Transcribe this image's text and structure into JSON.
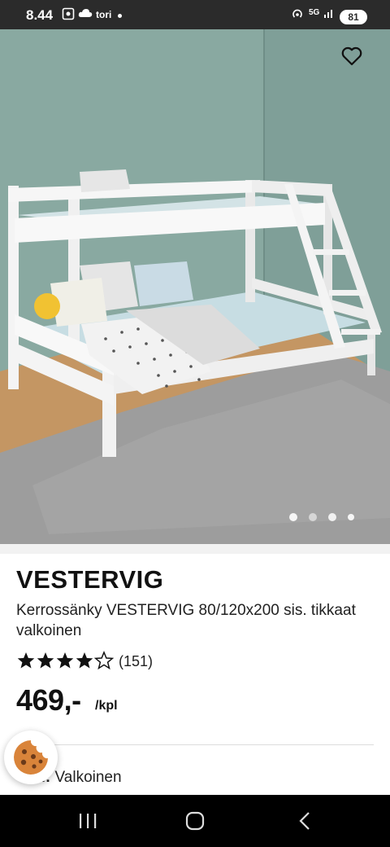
{
  "status_bar": {
    "time": "8.44",
    "carrier": "tori",
    "network": "5G",
    "battery": "81"
  },
  "hero": {
    "favorite_icon": "heart-outline-icon",
    "carousel": {
      "count": 4,
      "active": 0
    }
  },
  "product": {
    "name": "VESTERVIG",
    "description": "Kerrossänky VESTERVIG 80/120x200 sis. tikkaat valkoinen",
    "rating": {
      "value": 4,
      "max": 5,
      "count_label": "(151)"
    },
    "price": "469,-",
    "unit": "/kpl",
    "variant_label": "Väri:",
    "variant_value": "Valkoinen"
  },
  "cookie_button": {
    "icon": "cookie-icon"
  },
  "nav_bar": {
    "icons": [
      "recent-apps-icon",
      "home-icon",
      "back-icon"
    ]
  },
  "colors": {
    "wall": "#88a8a0",
    "rug": "#9d9d9d",
    "floor": "#c49663",
    "accent_dark": "#111111"
  }
}
